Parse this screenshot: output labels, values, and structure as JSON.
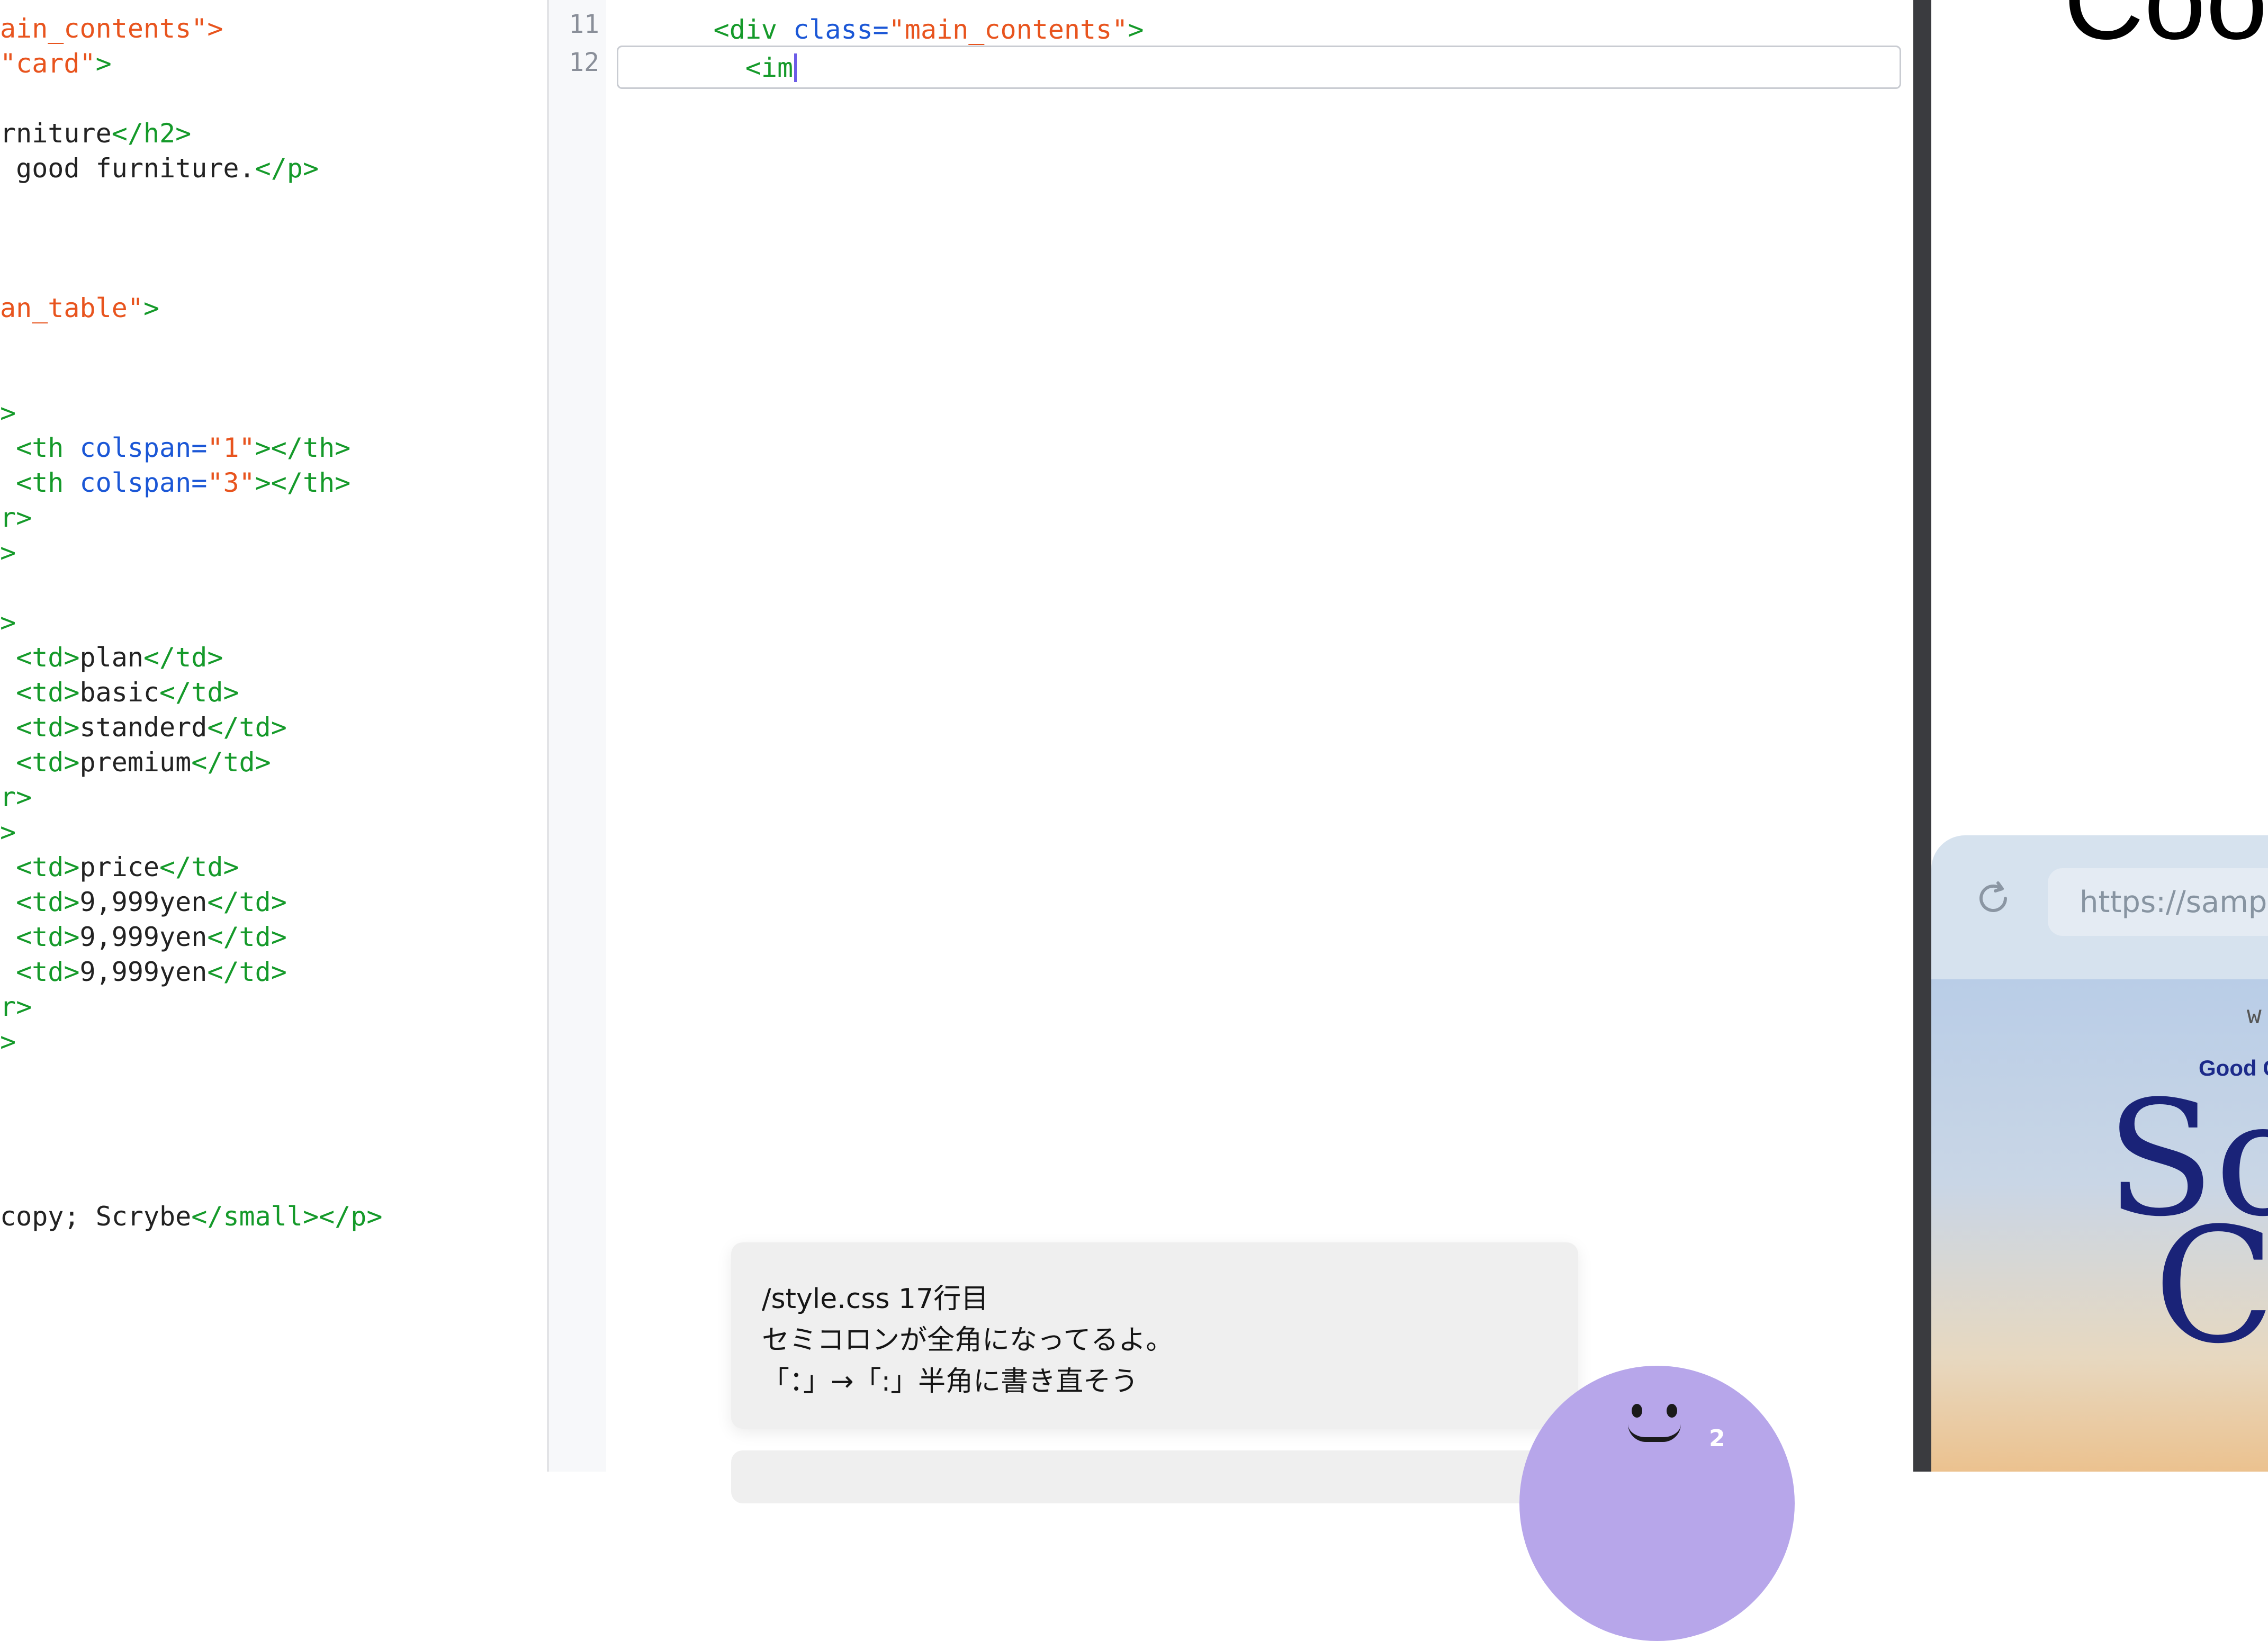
{
  "left_code": {
    "lines": [
      {
        "parts": [
          {
            "t": "ain_contents\">",
            "c": "str"
          }
        ]
      },
      {
        "parts": [
          {
            "t": "\"card\"",
            "c": "str"
          },
          {
            "t": ">",
            "c": "tag"
          }
        ]
      },
      {
        "parts": []
      },
      {
        "parts": [
          {
            "t": "rniture",
            "c": "text"
          },
          {
            "t": "</h2>",
            "c": "tag"
          }
        ]
      },
      {
        "parts": [
          {
            "t": " good furniture.",
            "c": "text"
          },
          {
            "t": "</p>",
            "c": "tag"
          }
        ]
      },
      {
        "parts": []
      },
      {
        "parts": []
      },
      {
        "parts": []
      },
      {
        "parts": [
          {
            "t": "an_table\"",
            "c": "str"
          },
          {
            "t": ">",
            "c": "tag"
          }
        ]
      },
      {
        "parts": []
      },
      {
        "parts": []
      },
      {
        "parts": [
          {
            "t": ">",
            "c": "tag"
          }
        ]
      },
      {
        "parts": [
          {
            "t": " <th ",
            "c": "tag"
          },
          {
            "t": "colspan=",
            "c": "attr"
          },
          {
            "t": "\"1\"",
            "c": "str"
          },
          {
            "t": "></th>",
            "c": "tag"
          }
        ]
      },
      {
        "parts": [
          {
            "t": " <th ",
            "c": "tag"
          },
          {
            "t": "colspan=",
            "c": "attr"
          },
          {
            "t": "\"3\"",
            "c": "str"
          },
          {
            "t": "></th>",
            "c": "tag"
          }
        ]
      },
      {
        "parts": [
          {
            "t": "r>",
            "c": "tag"
          }
        ]
      },
      {
        "parts": [
          {
            "t": ">",
            "c": "tag"
          }
        ]
      },
      {
        "parts": []
      },
      {
        "parts": [
          {
            "t": ">",
            "c": "tag"
          }
        ]
      },
      {
        "parts": [
          {
            "t": " <td>",
            "c": "tag"
          },
          {
            "t": "plan",
            "c": "text"
          },
          {
            "t": "</td>",
            "c": "tag"
          }
        ]
      },
      {
        "parts": [
          {
            "t": " <td>",
            "c": "tag"
          },
          {
            "t": "basic",
            "c": "text"
          },
          {
            "t": "</td>",
            "c": "tag"
          }
        ]
      },
      {
        "parts": [
          {
            "t": " <td>",
            "c": "tag"
          },
          {
            "t": "standerd",
            "c": "text"
          },
          {
            "t": "</td>",
            "c": "tag"
          }
        ]
      },
      {
        "parts": [
          {
            "t": " <td>",
            "c": "tag"
          },
          {
            "t": "premium",
            "c": "text"
          },
          {
            "t": "</td>",
            "c": "tag"
          }
        ]
      },
      {
        "parts": [
          {
            "t": "r>",
            "c": "tag"
          }
        ]
      },
      {
        "parts": [
          {
            "t": ">",
            "c": "tag"
          }
        ]
      },
      {
        "parts": [
          {
            "t": " <td>",
            "c": "tag"
          },
          {
            "t": "price",
            "c": "text"
          },
          {
            "t": "</td>",
            "c": "tag"
          }
        ]
      },
      {
        "parts": [
          {
            "t": " <td>",
            "c": "tag"
          },
          {
            "t": "9,999yen",
            "c": "text"
          },
          {
            "t": "</td>",
            "c": "tag"
          }
        ]
      },
      {
        "parts": [
          {
            "t": " <td>",
            "c": "tag"
          },
          {
            "t": "9,999yen",
            "c": "text"
          },
          {
            "t": "</td>",
            "c": "tag"
          }
        ]
      },
      {
        "parts": [
          {
            "t": " <td>",
            "c": "tag"
          },
          {
            "t": "9,999yen",
            "c": "text"
          },
          {
            "t": "</td>",
            "c": "tag"
          }
        ]
      },
      {
        "parts": [
          {
            "t": "r>",
            "c": "tag"
          }
        ]
      },
      {
        "parts": [
          {
            "t": ">",
            "c": "tag"
          }
        ]
      },
      {
        "parts": []
      },
      {
        "parts": []
      },
      {
        "parts": []
      },
      {
        "parts": []
      },
      {
        "parts": [
          {
            "t": "copy; Scrybe",
            "c": "text"
          },
          {
            "t": "</small></p>",
            "c": "tag"
          }
        ]
      }
    ]
  },
  "editor": {
    "line_numbers": [
      "11",
      "12"
    ],
    "line11": {
      "indent": "      ",
      "tag_open": "<div ",
      "attr": "class=",
      "value": "\"main_contents\"",
      "tag_close": ">"
    },
    "line12": {
      "indent": "        ",
      "text": "<im"
    }
  },
  "preview": {
    "title_fragment": "Coo",
    "url_text": "https://sampl",
    "mock_letter_w": "w",
    "brand_text": "Good C",
    "hero_line1": "Sc",
    "hero_line2": "C"
  },
  "toast": {
    "file_line": "/style.css 17行目",
    "message_line1": "セミコロンが全角になってるよ。",
    "message_line2": "「：」→「:」半角に書き直そう"
  },
  "mascot": {
    "badge_count": "2"
  },
  "colors": {
    "tag": "#159a2a",
    "attribute": "#1b57d6",
    "string": "#e8541e",
    "text": "#222222",
    "caret": "#6c5ce7",
    "mascot": "#b7a6ea"
  }
}
